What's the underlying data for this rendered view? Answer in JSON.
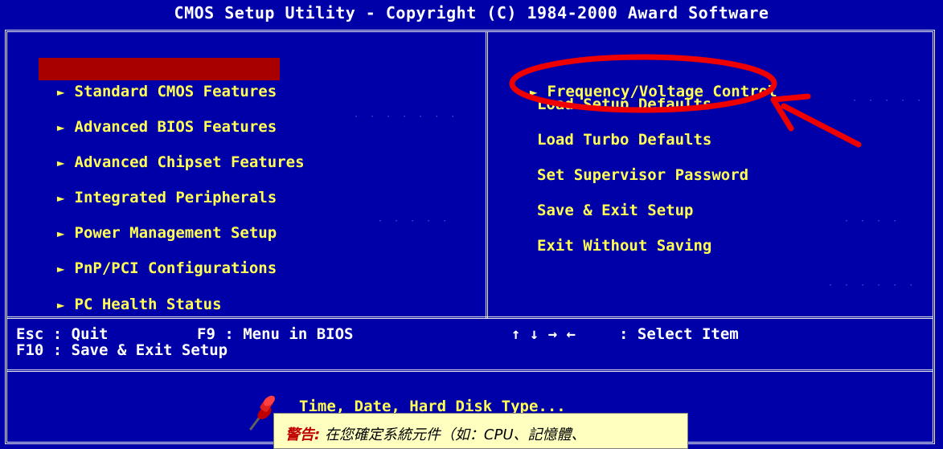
{
  "title": "CMOS Setup Utility - Copyright (C) 1984-2000 Award Software",
  "left_menu": [
    {
      "label": "Standard CMOS Features",
      "selected": true
    },
    {
      "label": "Advanced BIOS Features",
      "selected": false
    },
    {
      "label": "Advanced Chipset Features",
      "selected": false
    },
    {
      "label": "Integrated Peripherals",
      "selected": false
    },
    {
      "label": "Power Management Setup",
      "selected": false
    },
    {
      "label": "PnP/PCI Configurations",
      "selected": false
    },
    {
      "label": "PC Health Status",
      "selected": false
    }
  ],
  "right_menu": [
    {
      "label": "Frequency/Voltage Control",
      "has_arrow": true
    },
    {
      "label": "Load Setup Defaults",
      "has_arrow": false
    },
    {
      "label": "Load Turbo Defaults",
      "has_arrow": false
    },
    {
      "label": "Set Supervisor Password",
      "has_arrow": false
    },
    {
      "label": "Save & Exit Setup",
      "has_arrow": false
    },
    {
      "label": "Exit Without Saving",
      "has_arrow": false
    }
  ],
  "keys": {
    "esc": "Esc : Quit",
    "f9": "F9 : Menu in BIOS",
    "arrows": "↑ ↓ → ←",
    "select": ": Select Item",
    "f10": "F10 : Save & Exit Setup"
  },
  "help_text": "Time, Date, Hard Disk Type...",
  "note": {
    "prefix": "警告:",
    "text": "在您確定系統元件（如：CPU、記憶體、"
  },
  "colors": {
    "background": "#0000a8",
    "menu_text": "#ffff54",
    "selection": "#a80000",
    "annotation": "#ee0000"
  }
}
